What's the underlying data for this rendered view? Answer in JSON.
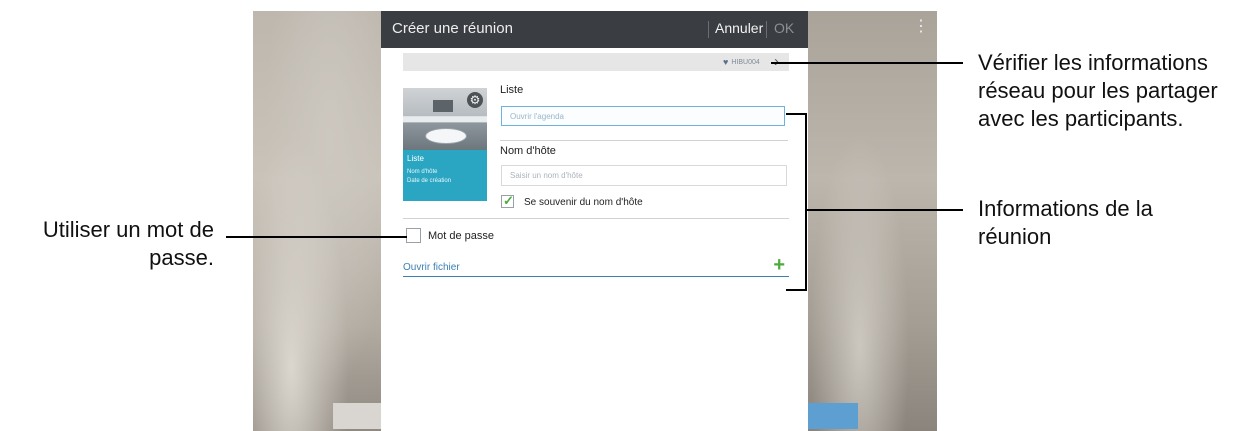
{
  "dialog": {
    "title": "Créer une réunion",
    "cancel_label": "Annuler",
    "ok_label": "OK"
  },
  "network_bar": {
    "name": "HIBU004",
    "heart_icon": "heart-icon",
    "chevron_icon": "chevron-right-icon"
  },
  "thumbnail": {
    "title": "Liste",
    "host_label": "Nom d'hôte",
    "date_label": "Date de création",
    "gear_icon": "gear-icon",
    "color": "#2aa6c2"
  },
  "form": {
    "liste_label": "Liste",
    "liste_placeholder": "Ouvrir l'agenda",
    "host_label": "Nom d'hôte",
    "host_placeholder": "Saisir un nom d'hôte",
    "remember_host_label": "Se souvenir du nom d'hôte",
    "remember_host_checked": true,
    "password_label": "Mot de passe",
    "password_checked": false,
    "open_file_label": "Ouvrir fichier",
    "open_file_icon": "plus-icon"
  },
  "annotations": {
    "network_info": "Vérifier les informations réseau pour les partager avec les participants.",
    "meeting_info": "Informations de la réunion",
    "password": "Utiliser un mot de passe."
  },
  "colors": {
    "accent_blue": "#3b7fb4",
    "accent_green": "#4bab3b",
    "title_bar": "#3a3d41",
    "bottom_button_blue": "#5c9fd0"
  }
}
